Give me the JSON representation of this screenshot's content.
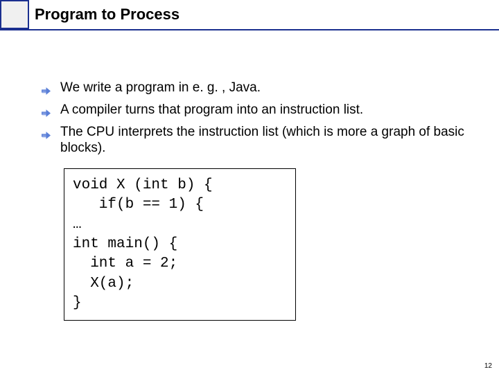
{
  "title": "Program to Process",
  "bullets": [
    "We write a program in e. g. , Java.",
    "A compiler turns that program into an instruction list.",
    "The CPU interprets the instruction list (which is more a graph of basic blocks)."
  ],
  "code": "void X (int b) {\n   if(b == 1) {\n…\nint main() {\n  int a = 2;\n  X(a);\n}",
  "page_number": "12",
  "colors": {
    "accent": "#1a2f8f",
    "bullet_fill": "#5a7fd8",
    "bullet_shadow": "#9fb3e8"
  }
}
